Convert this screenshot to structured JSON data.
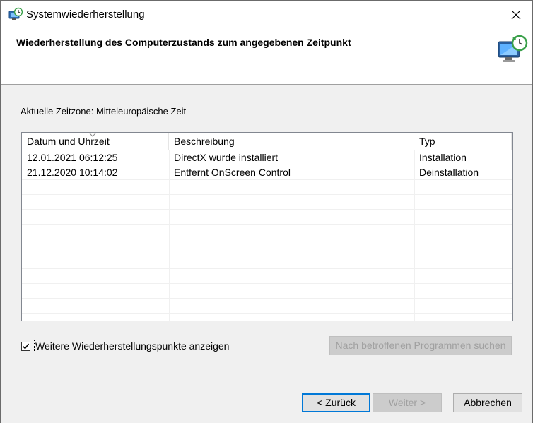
{
  "window": {
    "title": "Systemwiederherstellung"
  },
  "header": {
    "title": "Wiederherstellung des Computerzustands zum angegebenen Zeitpunkt"
  },
  "timezone_label": "Aktuelle Zeitzone: Mitteleuropäische Zeit",
  "list": {
    "columns": [
      "Datum und Uhrzeit",
      "Beschreibung",
      "Typ"
    ],
    "sorted_column": "Datum und Uhrzeit",
    "rows": [
      {
        "date": "12.01.2021 06:12:25",
        "description": "DirectX wurde installiert",
        "type": "Installation"
      },
      {
        "date": "21.12.2020 10:14:02",
        "description": "Entfernt OnScreen Control",
        "type": "Deinstallation"
      }
    ]
  },
  "show_more": {
    "label": "Weitere Wiederherstellungspunkte anzeigen",
    "checked": true
  },
  "buttons": {
    "search_programs": {
      "prefix": "N",
      "rest": "ach betroffenen Programmen suchen",
      "enabled": false
    },
    "back": {
      "prefix": "< ",
      "mnemonic": "Z",
      "rest": "urück",
      "enabled": true
    },
    "next": {
      "mnemonic": "W",
      "rest": "eiter >",
      "enabled": false
    },
    "cancel": {
      "label": "Abbrechen",
      "enabled": true
    }
  },
  "icons": {
    "app": "system-restore-icon",
    "header": "system-restore-monitor-icon",
    "close": "close-icon"
  }
}
